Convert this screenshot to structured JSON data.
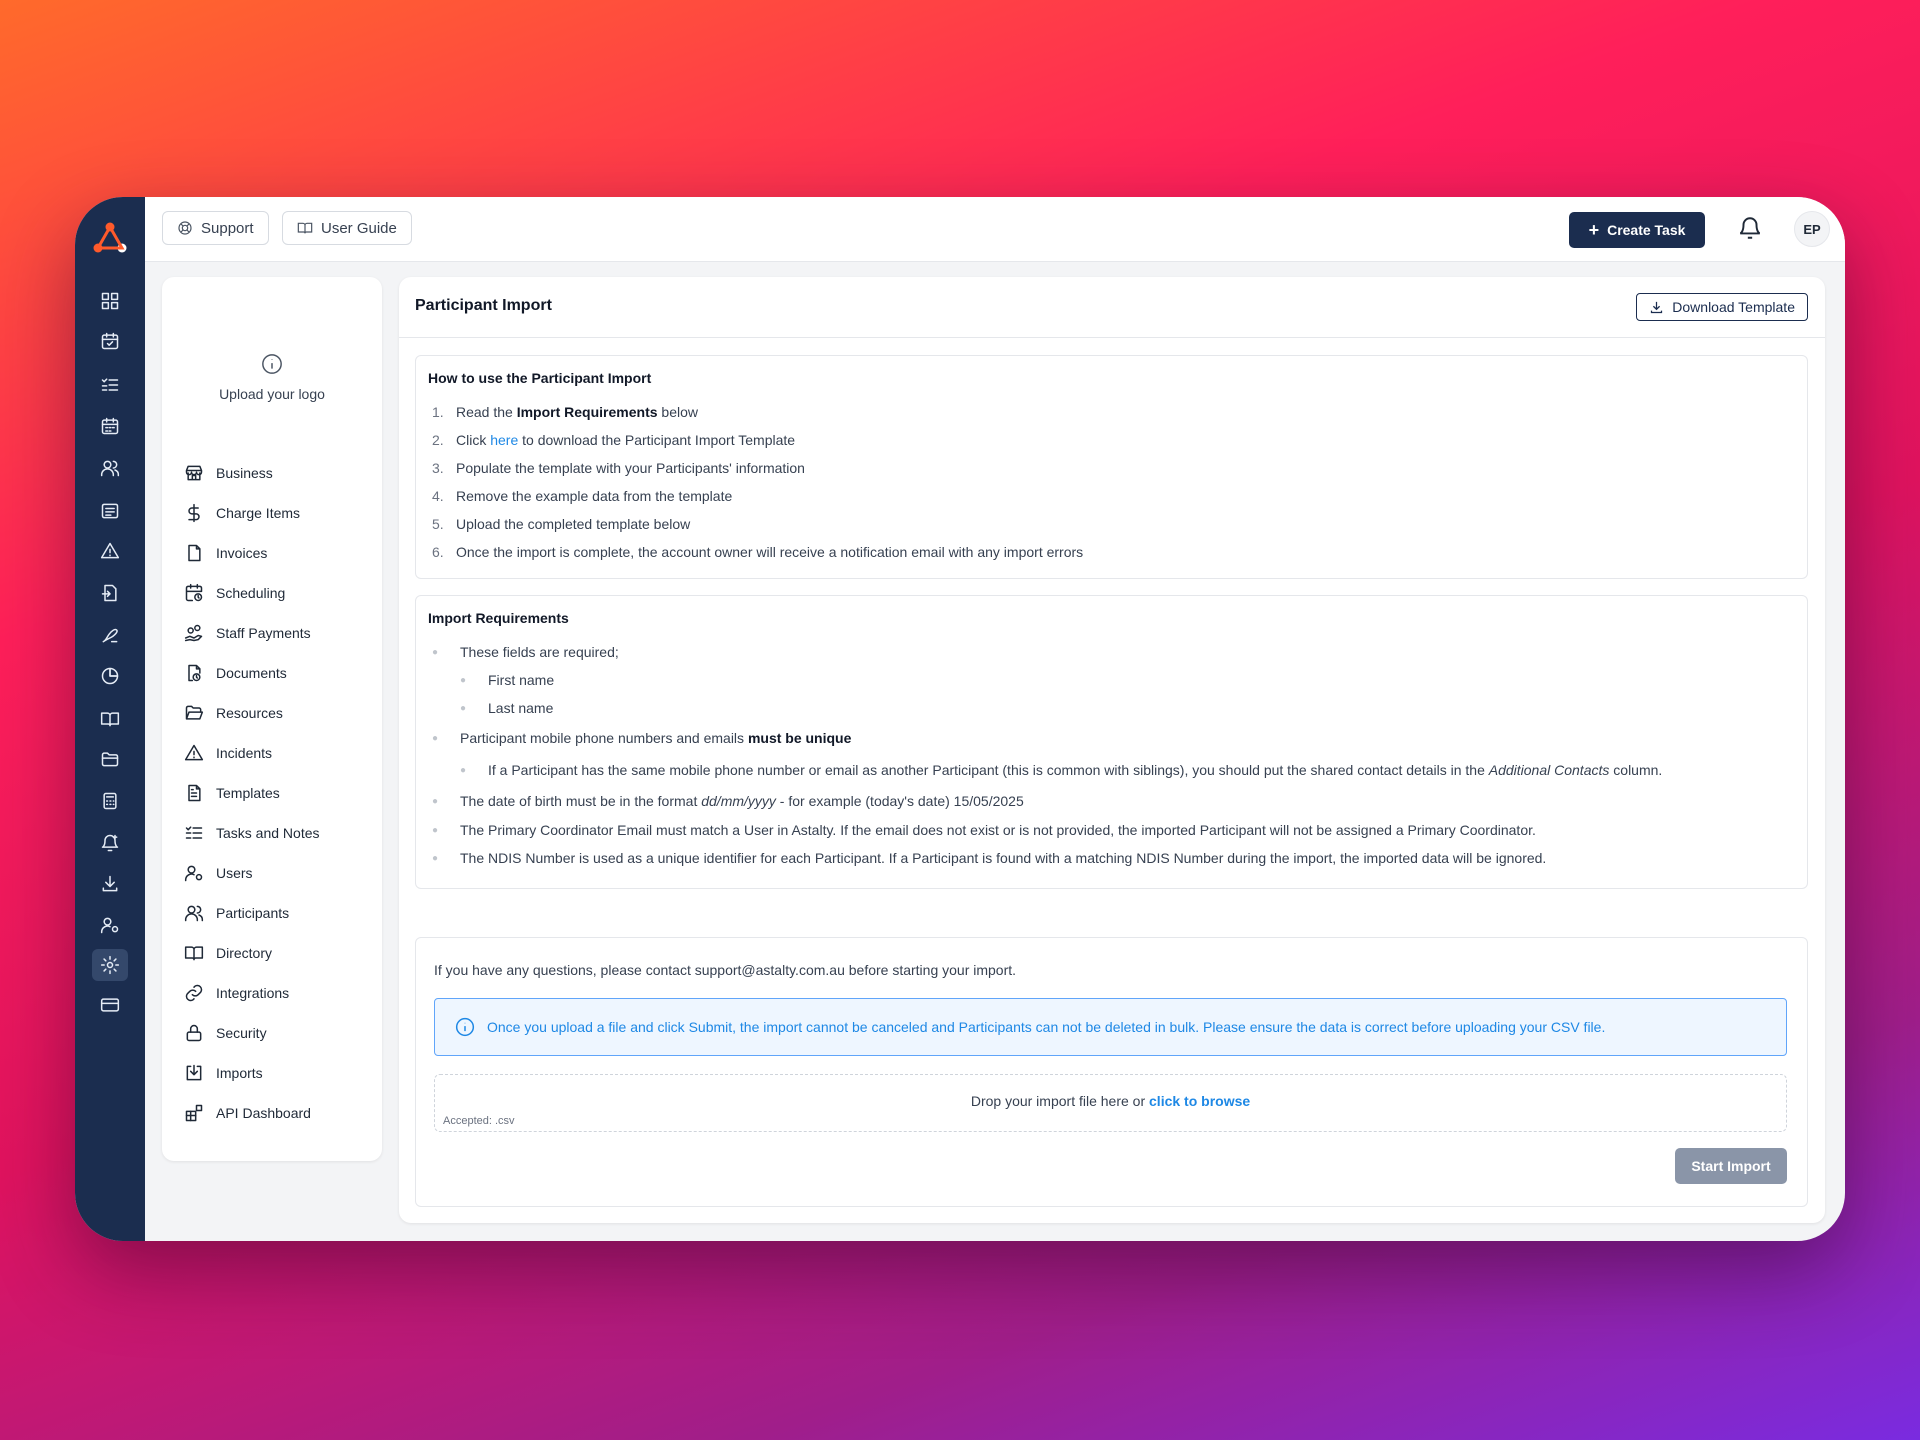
{
  "topbar": {
    "support_label": "Support",
    "user_guide_label": "User Guide",
    "create_task_label": "Create Task",
    "avatar_initials": "EP"
  },
  "rail": {
    "icons": [
      "dashboard-icon",
      "calendar-check-icon",
      "task-list-icon",
      "calendar-icon",
      "people-icon",
      "form-icon",
      "alert-icon",
      "file-import-icon",
      "signature-icon",
      "pie-chart-icon",
      "book-icon",
      "folder-icon",
      "calculator-icon",
      "bell-plus-icon",
      "download-icon",
      "user-gear-icon",
      "settings-icon",
      "card-icon"
    ],
    "active": "settings-icon"
  },
  "sidebar": {
    "upload_logo_label": "Upload your logo",
    "items": [
      {
        "label": "Business",
        "icon": "store-icon"
      },
      {
        "label": "Charge Items",
        "icon": "dollar-icon"
      },
      {
        "label": "Invoices",
        "icon": "file-icon"
      },
      {
        "label": "Scheduling",
        "icon": "calendar-clock-icon"
      },
      {
        "label": "Staff Payments",
        "icon": "hand-coins-icon"
      },
      {
        "label": "Documents",
        "icon": "document-clock-icon"
      },
      {
        "label": "Resources",
        "icon": "folder-open-icon"
      },
      {
        "label": "Incidents",
        "icon": "warning-icon"
      },
      {
        "label": "Templates",
        "icon": "file-text-icon"
      },
      {
        "label": "Tasks and Notes",
        "icon": "list-checks-icon"
      },
      {
        "label": "Users",
        "icon": "user-cog-icon"
      },
      {
        "label": "Participants",
        "icon": "users-icon"
      },
      {
        "label": "Directory",
        "icon": "book-open-icon"
      },
      {
        "label": "Integrations",
        "icon": "link-icon"
      },
      {
        "label": "Security",
        "icon": "lock-icon"
      },
      {
        "label": "Imports",
        "icon": "import-icon"
      },
      {
        "label": "API Dashboard",
        "icon": "api-icon"
      }
    ]
  },
  "main": {
    "title": "Participant Import",
    "download_template_label": "Download Template",
    "howto": {
      "title": "How to use the Participant Import",
      "steps": [
        {
          "n": "1.",
          "pre": "Read the ",
          "bold": "Import Requirements",
          "post": " below"
        },
        {
          "n": "2.",
          "pre": "Click ",
          "link": "here",
          "post": " to download the Participant Import Template"
        },
        {
          "n": "3.",
          "text": "Populate the template with your Participants' information"
        },
        {
          "n": "4.",
          "text": "Remove the example data from the template"
        },
        {
          "n": "5.",
          "text": "Upload the completed template below"
        },
        {
          "n": "6.",
          "text": "Once the import is complete, the account owner will receive a notification email with any import errors"
        }
      ]
    },
    "requirements": {
      "title": "Import Requirements",
      "fields_required": "These fields are required;",
      "first_name": "First name",
      "last_name": "Last name",
      "unique_pre": "Participant mobile phone numbers and emails ",
      "unique_bold": "must be unique",
      "sibling_pre": "If a Participant has the same mobile phone number or email as another Participant (this is common with siblings), you should put the shared contact details in the ",
      "sibling_italic": "Additional Contacts",
      "sibling_post": " column.",
      "dob_pre": "The date of birth must be in the format ",
      "dob_italic": "dd/mm/yyyy",
      "dob_post": " - for example (today's date) 15/05/2025",
      "coordinator": "The Primary Coordinator Email must match a User in Astalty. If the email does not exist or is not provided, the imported Participant will not be assigned a Primary Coordinator.",
      "ndis": "The NDIS Number is used as a unique identifier for each Participant. If a Participant is found with a matching NDIS Number during the import, the imported data will be ignored."
    },
    "upload": {
      "questions": "If you have any questions, please contact support@astalty.com.au before starting your import.",
      "warning": "Once you upload a file and click Submit, the import cannot be canceled and Participants can not be deleted in bulk. Please ensure the data is correct before uploading your CSV file.",
      "drop_text": "Drop your import file here or ",
      "browse_link": "click to browse",
      "accepted": "Accepted: .csv",
      "start_label": "Start Import"
    }
  }
}
